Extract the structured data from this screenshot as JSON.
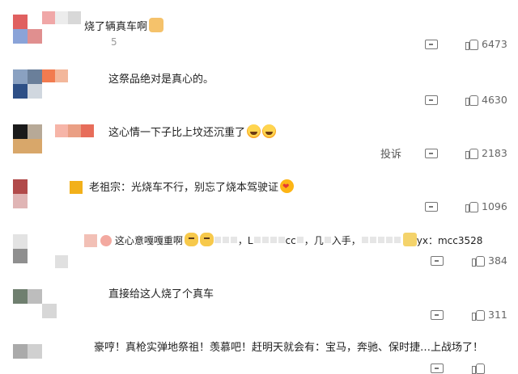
{
  "colors": {
    "text": "#1f1f1f",
    "muted": "#9a9a9a",
    "icon": "#777777"
  },
  "comments": [
    {
      "text": "烧了辆真车啊",
      "emoji": "thumbs-up",
      "reply_count": "5",
      "likes": "6473",
      "avatar_colors": [
        "#e06060",
        "#ffffff",
        "#8aa3d8",
        "#e08f8f"
      ],
      "name_colors": [
        "#f0a7a7",
        "#ececec",
        "#d8d8d8"
      ]
    },
    {
      "text": "这祭品绝对是真心的。",
      "likes": "4630",
      "avatar_colors": [
        "#8aa1c1",
        "#6a7f9a",
        "#2d4f86",
        "#d0d7df"
      ],
      "name_colors": [
        "#f27b4f",
        "#f3b79b"
      ]
    },
    {
      "text": "这心情一下子比上坟还沉重了",
      "emojis": [
        "laugh",
        "laugh"
      ],
      "report_label": "投诉",
      "likes": "2183",
      "avatar_colors": [
        "#1a1a1a",
        "#b7a997",
        "#d8a76a",
        "#d8a76a"
      ],
      "name_colors": [
        "#f6b5a8",
        "#ea9f84",
        "#e76d5a"
      ]
    },
    {
      "text": "老祖宗：光烧车不行，别忘了烧本驾驶证",
      "emoji": "heart-eyes",
      "likes": "1096",
      "avatar_colors": [
        "#b14a4a",
        "#ffffff",
        "#e0b5b5",
        "#ffffff"
      ],
      "name_colors": [
        "#f2b01a"
      ]
    },
    {
      "text": "这心意嘎嘎重啊",
      "text_b": "，L",
      "text_c": "cc",
      "text_d": "，几",
      "text_e": "入手，",
      "text_f": "yx：mcc3528",
      "likes": "384",
      "avatar_colors": [
        "#e3e3e3",
        "#ffffff",
        "#8f8f8f",
        "#e0e0e0"
      ],
      "name_colors": [
        "#f2c0b6"
      ]
    },
    {
      "text": "直接给这人烧了个真车",
      "likes": "311",
      "avatar_colors": [
        "#6f7f6f",
        "#bdbdbd",
        "#ffffff",
        "#d7d7d7"
      ],
      "name_colors": []
    },
    {
      "text": "豪哼！真枪实弹地祭祖！羡慕吧！赶明天就会有：宝马，奔驰、保时捷…上战场了！",
      "likes": "",
      "avatar_colors": [
        "#aaaaaa",
        "#d0d0d0",
        "#ffffff",
        "#ffffff"
      ],
      "name_colors": []
    }
  ]
}
